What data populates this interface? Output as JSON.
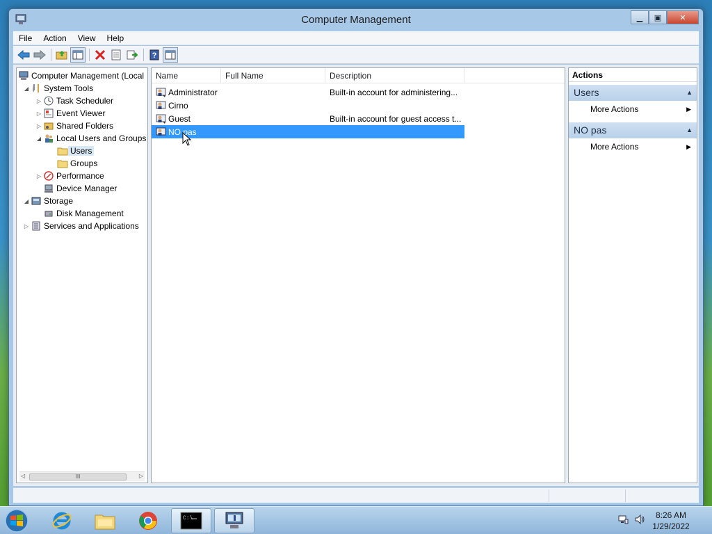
{
  "window": {
    "title": "Computer Management",
    "controls": [
      "minimize",
      "maximize",
      "close"
    ]
  },
  "menu": [
    "File",
    "Action",
    "View",
    "Help"
  ],
  "toolbar": {
    "icons": [
      "back-arrow-icon",
      "forward-arrow-icon",
      "up-folder-icon",
      "show-hide-tree-icon",
      "delete-icon",
      "properties-icon",
      "export-list-icon",
      "help-icon",
      "show-hide-action-pane-icon"
    ]
  },
  "tree": {
    "items": [
      {
        "label": "Computer Management (Local",
        "level": 0,
        "expander": "",
        "icon": "computer-management-icon"
      },
      {
        "label": "System Tools",
        "level": 1,
        "expander": "◢",
        "icon": "tools-icon"
      },
      {
        "label": "Task Scheduler",
        "level": 2,
        "expander": "▷",
        "icon": "clock-icon"
      },
      {
        "label": "Event Viewer",
        "level": 2,
        "expander": "▷",
        "icon": "event-viewer-icon"
      },
      {
        "label": "Shared Folders",
        "level": 2,
        "expander": "▷",
        "icon": "shared-folder-icon"
      },
      {
        "label": "Local Users and Groups",
        "level": 2,
        "expander": "◢",
        "icon": "users-groups-icon"
      },
      {
        "label": "Users",
        "level": 3,
        "expander": "",
        "icon": "folder-icon",
        "selected": true
      },
      {
        "label": "Groups",
        "level": 3,
        "expander": "",
        "icon": "folder-icon"
      },
      {
        "label": "Performance",
        "level": 2,
        "expander": "▷",
        "icon": "performance-icon"
      },
      {
        "label": "Device Manager",
        "level": 2,
        "expander": "",
        "icon": "device-manager-icon"
      },
      {
        "label": "Storage",
        "level": 1,
        "expander": "◢",
        "icon": "storage-icon"
      },
      {
        "label": "Disk Management",
        "level": 2,
        "expander": "",
        "icon": "disk-icon"
      },
      {
        "label": "Services and Applications",
        "level": 1,
        "expander": "▷",
        "icon": "services-icon"
      }
    ],
    "scroll_thumb": "III"
  },
  "list": {
    "columns": [
      "Name",
      "Full Name",
      "Description"
    ],
    "rows": [
      {
        "name": "Administrator",
        "full_name": "",
        "description": "Built-in account for administering..."
      },
      {
        "name": "Cirno",
        "full_name": "",
        "description": ""
      },
      {
        "name": "Guest",
        "full_name": "",
        "description": "Built-in account for guest access t..."
      },
      {
        "name": "NO pas",
        "full_name": "",
        "description": "",
        "selected": true
      }
    ]
  },
  "actions": {
    "title": "Actions",
    "groups": [
      {
        "label": "Users",
        "items": [
          "More Actions"
        ]
      },
      {
        "label": "NO pas",
        "items": [
          "More Actions"
        ]
      }
    ]
  },
  "taskbar": {
    "apps": [
      "internet-explorer-icon",
      "file-explorer-icon",
      "chrome-icon",
      "command-prompt-icon",
      "computer-management-icon"
    ],
    "time": "8:26 AM",
    "date": "1/29/2022"
  },
  "colors": {
    "selection": "#3399ff",
    "tree_selection": "#d9e8f5",
    "action_group": "#c4d8ed"
  }
}
